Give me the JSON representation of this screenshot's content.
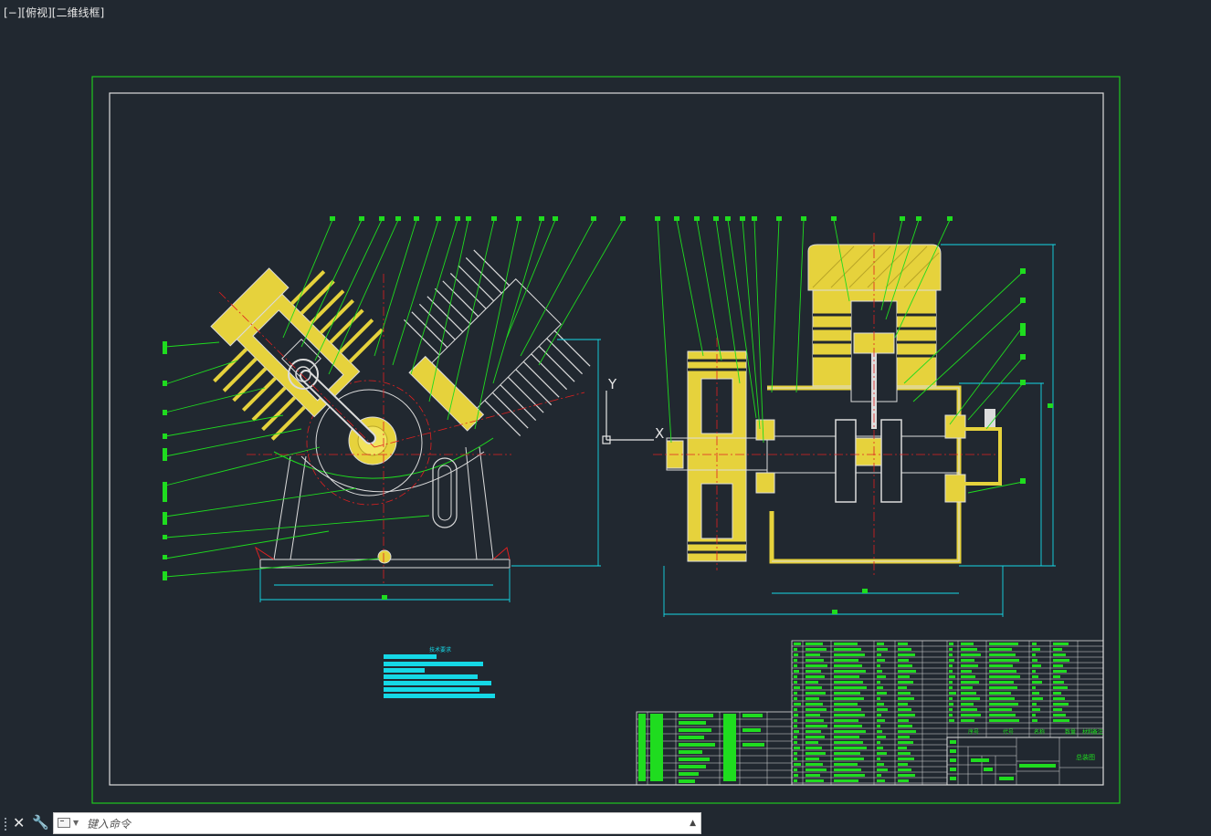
{
  "viewport": {
    "label": "[−][俯视][二维线框]"
  },
  "ucs": {
    "y_label": "Y",
    "x_label": "X"
  },
  "title_block": {
    "title": "总装图"
  },
  "parts_table": {
    "header": [
      "序号",
      "代号",
      "名称",
      "数量",
      "材料",
      "备注"
    ]
  },
  "tech_notes": {
    "title": "技术要求"
  },
  "command_line": {
    "placeholder": "键入命令"
  },
  "colors": {
    "background": "#212830",
    "border_green": "#1ec71e",
    "frame_white": "#dcdcdc",
    "part_yellow": "#e6d23c",
    "leader_green": "#1fdc1f",
    "dim_cyan": "#15d8e6",
    "center_red": "#e02020"
  },
  "icons": [
    "close-icon",
    "wrench-icon",
    "command-prompt-icon",
    "chevron-up-icon"
  ]
}
